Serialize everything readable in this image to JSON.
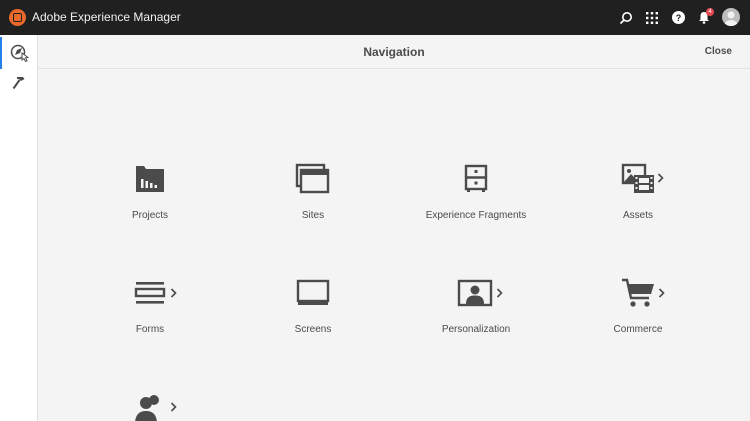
{
  "app": {
    "title": "Adobe Experience Manager",
    "notification_count": "4"
  },
  "header": {
    "title": "Navigation",
    "close_label": "Close"
  },
  "rail": {
    "items": [
      {
        "name": "navigation",
        "active": true
      },
      {
        "name": "tools",
        "active": false
      }
    ]
  },
  "tiles": [
    {
      "label": "Projects",
      "icon": "projects-folder-icon",
      "has_children": false
    },
    {
      "label": "Sites",
      "icon": "sites-windows-icon",
      "has_children": false
    },
    {
      "label": "Experience Fragments",
      "icon": "experience-fragments-cabinet-icon",
      "has_children": false
    },
    {
      "label": "Assets",
      "icon": "assets-media-icon",
      "has_children": true
    },
    {
      "label": "Forms",
      "icon": "forms-lines-icon",
      "has_children": true
    },
    {
      "label": "Screens",
      "icon": "screens-monitor-icon",
      "has_children": false
    },
    {
      "label": "Personalization",
      "icon": "personalization-portrait-icon",
      "has_children": true
    },
    {
      "label": "Commerce",
      "icon": "commerce-cart-icon",
      "has_children": true
    },
    {
      "label": "",
      "icon": "communities-users-icon",
      "has_children": true
    }
  ],
  "colors": {
    "topbar": "#202020",
    "accent": "#2680eb",
    "icon": "#4b4b4b",
    "badge": "#e34850",
    "logo": "#e8692b"
  }
}
